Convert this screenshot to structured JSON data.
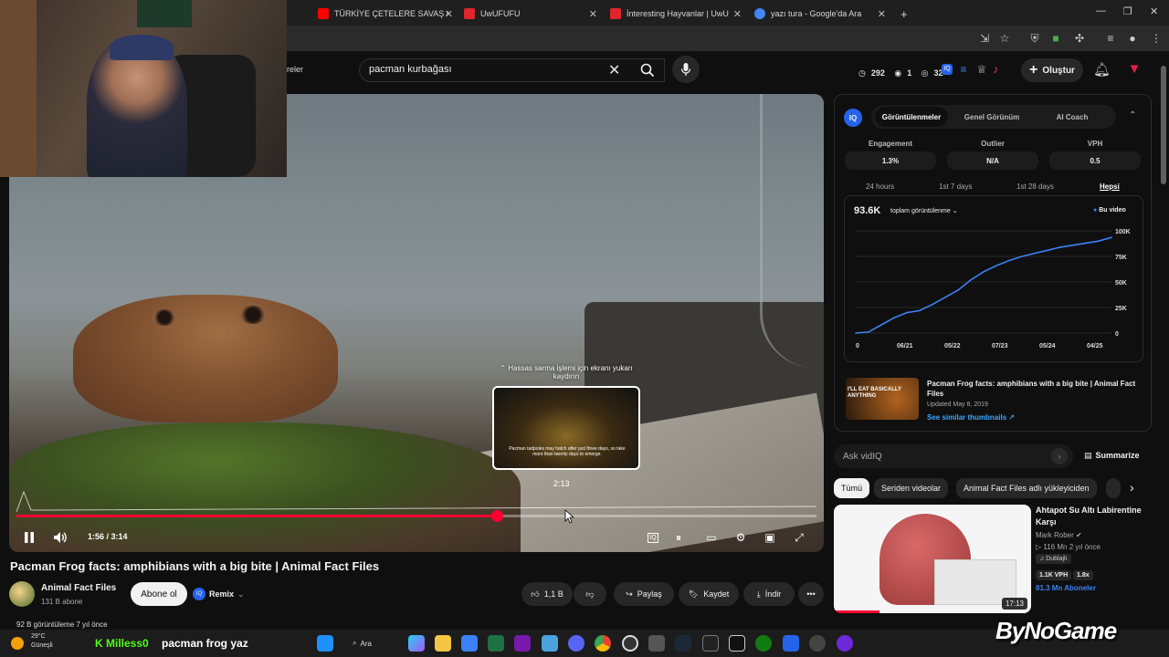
{
  "browser": {
    "tabs": [
      {
        "label": "TÜRKİYE ÇETELERE SAVAŞ AÇTI",
        "favicon_color": "#ff0000"
      },
      {
        "label": "UwUFUFU",
        "favicon_color": "#e0252e"
      },
      {
        "label": "İnteresting Hayvanlar | UwUFUFU",
        "favicon_color": "#e0252e"
      },
      {
        "label": "yazı tura - Google'da Ara",
        "favicon_color": "#4285f4"
      }
    ],
    "new_tab": "+",
    "partial_tab_text": "reler"
  },
  "header": {
    "search_value": "pacman kurbağası",
    "stats": {
      "views": "292",
      "count_b": "1",
      "count_c": "32"
    },
    "create_label": "Oluştur"
  },
  "player": {
    "hint": "Hassas sarma işlemi için ekranı yukarı kaydırın",
    "preview_caption": "Pacman tadpoles may hatch after just three days, so take more than twenty days to emerge.",
    "preview_time": "2:13",
    "time_text": "1:56 / 3:14",
    "progress_fraction": 0.6,
    "accent": "#ff0033"
  },
  "video": {
    "title": "Pacman Frog facts: amphibians with a big bite | Animal Fact Files",
    "channel": "Animal Fact Files",
    "subs": "131 B abone",
    "subscribe": "Abone ol",
    "remix": "Remix",
    "likes": "1,1 B",
    "share": "Paylaş",
    "save": "Kaydet",
    "download": "İndir",
    "views_line": "92 B görüntüleme 7 yıl önce"
  },
  "vidiq": {
    "tabs": [
      "Görüntülenmeler",
      "Genel Görünüm",
      "AI Coach"
    ],
    "metrics": [
      {
        "label": "Engagement",
        "value": "1.3%"
      },
      {
        "label": "Outlier",
        "value": "N/A"
      },
      {
        "label": "VPH",
        "value": "0.5"
      }
    ],
    "ranges": [
      "24 hours",
      "1st 7 days",
      "1st 28 days",
      "Hepsi"
    ],
    "total": "93.6K",
    "total_dropdown": "toplam görüntülenme",
    "legend": "Bu video",
    "video_title": "Pacman Frog facts: amphibians with a big bite | Animal Fact Files",
    "updated": "Updated May 8, 2019",
    "similar_link": "See similar thumbnails",
    "thumb_text": "I'LL EAT BASICALLY ANYTHING",
    "ask_placeholder": "Ask vidIQ",
    "summarize": "Summarize"
  },
  "chart_data": {
    "type": "line",
    "x": [
      "06/21",
      "05/22",
      "07/23",
      "05/24",
      "04/25"
    ],
    "y_ticks": [
      "100K",
      "75K",
      "50K",
      "25K",
      "0"
    ],
    "x_start_label": "0",
    "ylim": [
      0,
      100000
    ],
    "series": [
      {
        "name": "Bu video",
        "color": "#3b82f6",
        "values": [
          0,
          1000,
          8000,
          15000,
          20000,
          22000,
          28000,
          35000,
          42000,
          52000,
          60000,
          66000,
          71000,
          75000,
          78000,
          81000,
          84000,
          86000,
          88000,
          90000,
          93600
        ]
      }
    ]
  },
  "chips": [
    "Tümü",
    "Seriden videolar",
    "Animal Fact Files adlı yükleyiciden"
  ],
  "recommended": {
    "title": "Ahtapot Su Altı Labirentine Karşı",
    "channel": "Mark Rober",
    "meta": "116 Mn  2 yıl önce",
    "badge": "Dublajlı",
    "vph": "1.1K VPH",
    "multiplier": "1.8x",
    "subs": "81.3 Mn Aboneler",
    "duration": "17:13"
  },
  "taskbar": {
    "temp": "29°C",
    "desc": "Güneşli",
    "search": "Ara",
    "chat_user": "Milless0",
    "chat_msg": "pacman frog yaz",
    "watermark": "ByNoGame"
  }
}
